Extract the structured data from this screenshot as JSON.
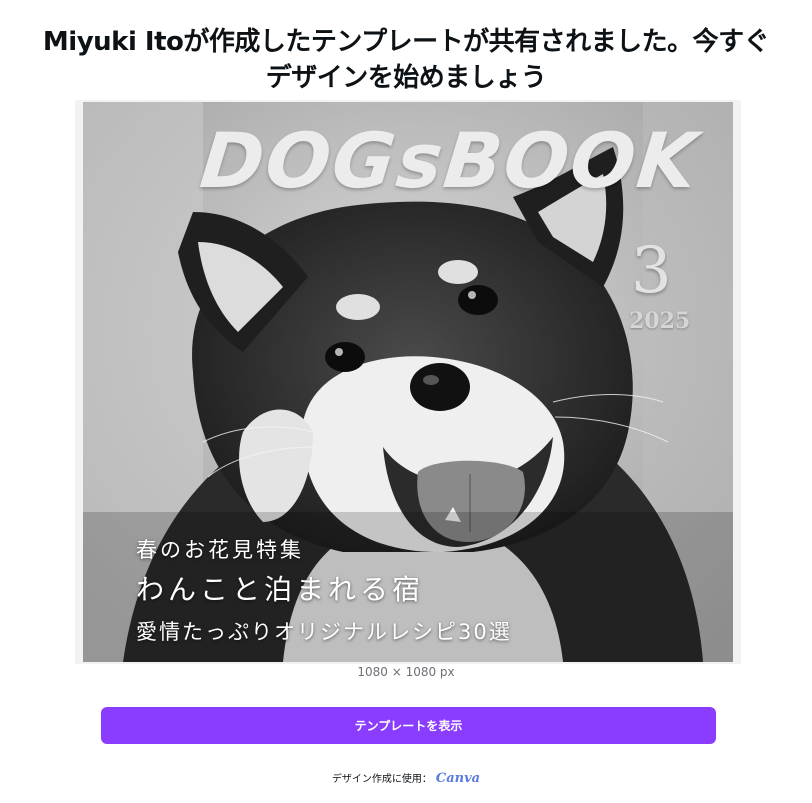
{
  "headline": "Miyuki Itoが作成したテンプレートが共有されました。今すぐデザインを始めましょう",
  "cover": {
    "title": "DOGsBOOK",
    "issue_number": "3",
    "year": "2025",
    "feature_1": "春のお花見特集",
    "feature_2": "わんこと泊まれる宿",
    "feature_3": "愛情たっぷりオリジナルレシピ30選"
  },
  "dimensions_label": "1080 × 1080 px",
  "cta_label": "テンプレートを表示",
  "footer": {
    "prefix": "デザイン作成に使用：",
    "brand": "Canva"
  },
  "colors": {
    "accent": "#8b3dff",
    "brand_logo": "#5a7be0"
  }
}
